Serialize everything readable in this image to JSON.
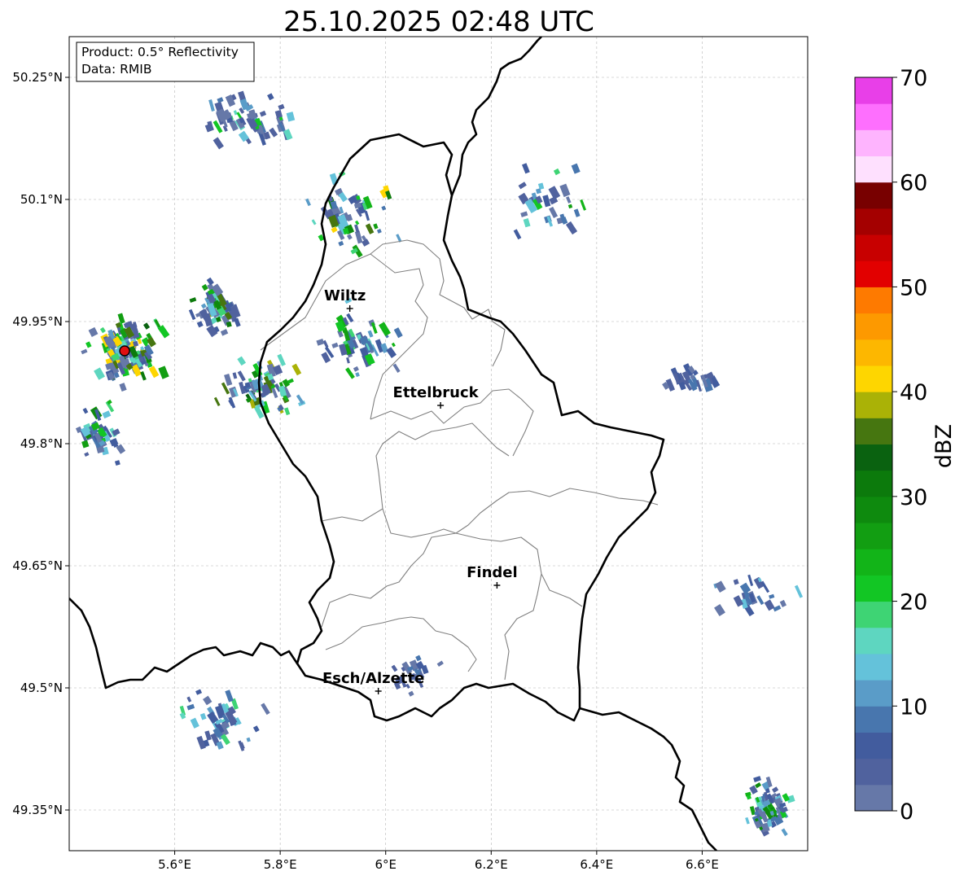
{
  "title": "25.10.2025 02:48 UTC",
  "info_box": {
    "product": "Product: 0.5° Reflectivity",
    "data": "Data: RMIB"
  },
  "colorbar": {
    "label": "dBZ",
    "ticks": [
      "0",
      "10",
      "20",
      "30",
      "40",
      "50",
      "60",
      "70"
    ],
    "range": [
      0,
      70
    ],
    "step": 2.5,
    "colors": [
      "#6678a8",
      "#50629e",
      "#425c9e",
      "#4876ae",
      "#5a9cc8",
      "#64c2da",
      "#5ed6c0",
      "#3ed474",
      "#12c624",
      "#12b418",
      "#129e12",
      "#0e8a0e",
      "#0c7a0c",
      "#0a6210",
      "#467610",
      "#aab206",
      "#fed600",
      "#fdb700",
      "#fd9900",
      "#fe7a00",
      "#e20000",
      "#c80000",
      "#a40000",
      "#780000",
      "#fee0fe",
      "#feb4fe",
      "#fe6ffe",
      "#e83fe8"
    ]
  },
  "chart_data": {
    "type": "map",
    "title": "25.10.2025 02:48 UTC",
    "x_axis": {
      "ticks": [
        5.6,
        5.8,
        6.0,
        6.2,
        6.4,
        6.6
      ],
      "tick_labels": [
        "5.6°E",
        "5.8°E",
        "6°E",
        "6.2°E",
        "6.4°E",
        "6.6°E"
      ],
      "range": [
        5.4,
        6.8
      ]
    },
    "y_axis": {
      "ticks": [
        50.25,
        50.1,
        49.95,
        49.8,
        49.65,
        49.5,
        49.35
      ],
      "tick_labels": [
        "50.25°N",
        "50.1°N",
        "49.95°N",
        "49.8°N",
        "49.65°N",
        "49.5°N",
        "49.35°N"
      ],
      "range": [
        49.3,
        50.3
      ]
    },
    "grid": true,
    "legend": "colorbar right",
    "unit": "dBZ",
    "radar_site": {
      "lon": 5.505,
      "lat": 49.914
    },
    "cities": [
      {
        "name": "Wiltz",
        "lon": 5.932,
        "lat": 49.966
      },
      {
        "name": "Ettelbruck",
        "lon": 6.104,
        "lat": 49.847
      },
      {
        "name": "Findel",
        "lon": 6.211,
        "lat": 49.626
      },
      {
        "name": "Esch/Alzette",
        "lon": 5.986,
        "lat": 49.496
      }
    ],
    "echo_clusters": [
      {
        "lon": 5.5,
        "lat": 49.92,
        "spread_lon": 0.09,
        "spread_lat": 0.05,
        "count": 120,
        "max_dbz": 45
      },
      {
        "lon": 5.67,
        "lat": 49.97,
        "spread_lon": 0.05,
        "spread_lat": 0.04,
        "count": 60,
        "max_dbz": 40
      },
      {
        "lon": 5.73,
        "lat": 50.2,
        "spread_lon": 0.12,
        "spread_lat": 0.04,
        "count": 60,
        "max_dbz": 22
      },
      {
        "lon": 5.75,
        "lat": 49.87,
        "spread_lon": 0.1,
        "spread_lat": 0.05,
        "count": 70,
        "max_dbz": 40
      },
      {
        "lon": 5.92,
        "lat": 50.08,
        "spread_lon": 0.12,
        "spread_lat": 0.07,
        "count": 55,
        "max_dbz": 45
      },
      {
        "lon": 5.95,
        "lat": 49.93,
        "spread_lon": 0.1,
        "spread_lat": 0.06,
        "count": 50,
        "max_dbz": 28
      },
      {
        "lon": 5.45,
        "lat": 49.82,
        "spread_lon": 0.06,
        "spread_lat": 0.05,
        "count": 40,
        "max_dbz": 30
      },
      {
        "lon": 5.68,
        "lat": 49.46,
        "spread_lon": 0.1,
        "spread_lat": 0.05,
        "count": 45,
        "max_dbz": 20
      },
      {
        "lon": 6.72,
        "lat": 49.36,
        "spread_lon": 0.05,
        "spread_lat": 0.04,
        "count": 60,
        "max_dbz": 30
      },
      {
        "lon": 6.57,
        "lat": 49.88,
        "spread_lon": 0.07,
        "spread_lat": 0.02,
        "count": 25,
        "max_dbz": 10
      },
      {
        "lon": 6.7,
        "lat": 49.62,
        "spread_lon": 0.1,
        "spread_lat": 0.03,
        "count": 25,
        "max_dbz": 15
      },
      {
        "lon": 6.3,
        "lat": 50.1,
        "spread_lon": 0.1,
        "spread_lat": 0.06,
        "count": 30,
        "max_dbz": 30
      },
      {
        "lon": 6.05,
        "lat": 49.52,
        "spread_lon": 0.06,
        "spread_lat": 0.03,
        "count": 20,
        "max_dbz": 10
      }
    ]
  }
}
